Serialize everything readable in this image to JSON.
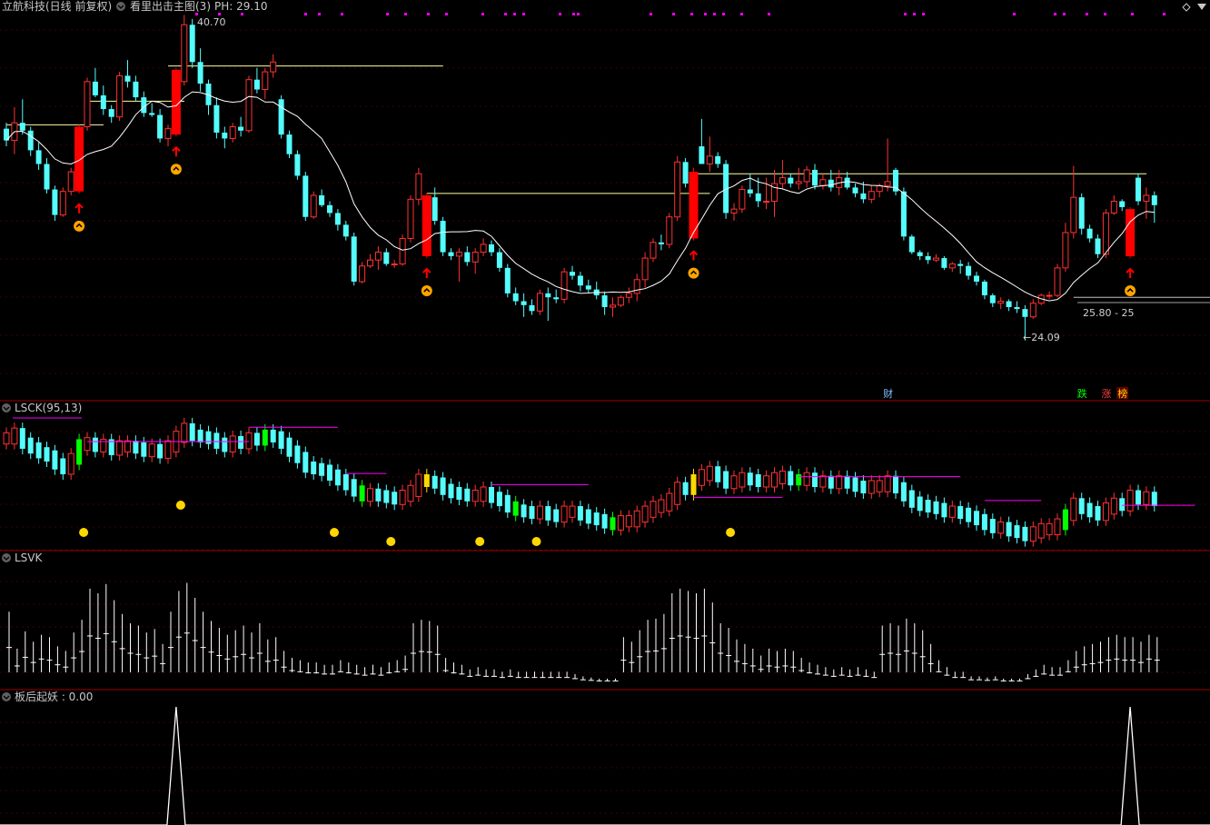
{
  "header": {
    "title": "立航科技(日线 前复权)",
    "indicator": "看里出击主图(3)",
    "ph": "PH: 29.10"
  },
  "panes": {
    "lsck": "LSCK(95,13)",
    "lsvk": "LSVK",
    "bhqy": "板后起妖 : 0.00"
  },
  "annotations": {
    "high_label": "40.70",
    "low_label": "←24.09",
    "range_label": "25.80 - 25",
    "tag_cai": "财",
    "tag_die": "跌",
    "tag_zhang": "涨",
    "tag_bang": "榜"
  },
  "colors": {
    "up": "#ff3232",
    "down": "#54fcfc",
    "signal": "#ff0000",
    "ma": "#ffffff",
    "level": "#ffffa0",
    "magenta": "#ff00ff",
    "gold": "#ffd700",
    "green": "#00ff00",
    "grid": "#400000",
    "divider": "#a00000"
  },
  "chart_data": {
    "type": "candlestick",
    "price_axis_range": [
      22.0,
      41.0
    ],
    "candles": [
      [
        34.9,
        35.2,
        34.0,
        34.3
      ],
      [
        34.3,
        36.0,
        33.6,
        35.2
      ],
      [
        35.2,
        36.4,
        34.6,
        34.8
      ],
      [
        34.8,
        35.0,
        33.5,
        33.8
      ],
      [
        33.8,
        34.2,
        32.8,
        33.1
      ],
      [
        33.1,
        33.4,
        31.6,
        31.8
      ],
      [
        31.8,
        32.0,
        30.2,
        30.5
      ],
      [
        30.5,
        31.9,
        30.4,
        31.7
      ],
      [
        31.7,
        32.9,
        31.5,
        32.7
      ],
      [
        32.6,
        35.1,
        32.2,
        35.0
      ],
      [
        35.0,
        37.5,
        34.8,
        37.3
      ],
      [
        37.3,
        38.0,
        36.5,
        36.6
      ],
      [
        36.6,
        37.1,
        35.6,
        35.9
      ],
      [
        35.9,
        36.1,
        35.2,
        35.5
      ],
      [
        35.5,
        37.8,
        35.3,
        37.6
      ],
      [
        37.6,
        38.4,
        37.0,
        37.3
      ],
      [
        37.3,
        37.6,
        36.3,
        36.5
      ],
      [
        36.5,
        36.8,
        35.5,
        35.7
      ],
      [
        35.7,
        36.2,
        35.5,
        35.6
      ],
      [
        35.6,
        35.9,
        34.2,
        34.4
      ],
      [
        34.4,
        35.1,
        34.0,
        34.9
      ],
      [
        34.9,
        37.5,
        34.6,
        37.3
      ],
      [
        37.3,
        40.7,
        37.1,
        40.2
      ],
      [
        40.2,
        40.5,
        38.0,
        38.3
      ],
      [
        38.3,
        39.0,
        36.8,
        37.2
      ],
      [
        37.2,
        37.4,
        35.6,
        36.1
      ],
      [
        36.1,
        36.5,
        34.4,
        34.7
      ],
      [
        34.7,
        35.0,
        33.9,
        34.4
      ],
      [
        34.4,
        35.2,
        34.2,
        35.0
      ],
      [
        35.0,
        35.5,
        34.5,
        34.8
      ],
      [
        34.8,
        37.6,
        34.7,
        37.4
      ],
      [
        37.4,
        38.0,
        36.7,
        36.9
      ],
      [
        36.9,
        38.0,
        36.4,
        37.8
      ],
      [
        37.8,
        38.7,
        37.5,
        38.3
      ],
      [
        36.4,
        36.6,
        34.4,
        34.6
      ],
      [
        34.6,
        34.8,
        33.4,
        33.6
      ],
      [
        33.6,
        33.8,
        32.3,
        32.5
      ],
      [
        32.5,
        32.7,
        30.2,
        30.4
      ],
      [
        30.4,
        31.7,
        30.3,
        31.5
      ],
      [
        31.5,
        31.8,
        30.9,
        31.0
      ],
      [
        31.0,
        31.2,
        30.4,
        30.6
      ],
      [
        30.6,
        30.8,
        29.7,
        30.0
      ],
      [
        30.0,
        30.2,
        29.2,
        29.4
      ],
      [
        29.4,
        29.6,
        26.9,
        27.1
      ],
      [
        27.1,
        28.1,
        27.0,
        27.9
      ],
      [
        27.9,
        28.5,
        27.8,
        28.2
      ],
      [
        28.2,
        28.9,
        27.7,
        28.6
      ],
      [
        28.6,
        28.8,
        27.9,
        28.0
      ],
      [
        28.0,
        28.2,
        27.8,
        28.0
      ],
      [
        28.0,
        29.5,
        27.9,
        29.3
      ],
      [
        29.3,
        31.5,
        29.1,
        31.3
      ],
      [
        31.3,
        32.9,
        31.0,
        32.6
      ],
      [
        32.6,
        33.5,
        31.1,
        31.4
      ],
      [
        31.4,
        31.9,
        30.0,
        30.2
      ],
      [
        30.2,
        30.4,
        28.4,
        28.6
      ],
      [
        28.6,
        28.8,
        28.2,
        28.4
      ],
      [
        28.4,
        28.8,
        27.1,
        28.6
      ],
      [
        28.6,
        28.9,
        27.9,
        28.1
      ],
      [
        28.1,
        28.8,
        27.5,
        28.6
      ],
      [
        28.6,
        29.3,
        28.4,
        29.0
      ],
      [
        29.0,
        29.2,
        28.4,
        28.6
      ],
      [
        28.6,
        28.8,
        27.6,
        27.8
      ],
      [
        27.8,
        28.0,
        26.3,
        26.5
      ],
      [
        26.5,
        26.8,
        25.9,
        26.1
      ],
      [
        26.1,
        26.5,
        25.3,
        25.9
      ],
      [
        25.9,
        26.2,
        25.4,
        25.6
      ],
      [
        25.6,
        26.7,
        25.4,
        26.5
      ],
      [
        26.5,
        26.8,
        25.1,
        26.3
      ],
      [
        26.3,
        26.7,
        26.0,
        26.2
      ],
      [
        26.2,
        27.8,
        26.0,
        27.6
      ],
      [
        27.6,
        27.9,
        27.2,
        27.4
      ],
      [
        27.4,
        27.6,
        26.6,
        26.9
      ],
      [
        26.9,
        27.2,
        26.5,
        26.7
      ],
      [
        26.7,
        27.1,
        26.2,
        26.4
      ],
      [
        26.4,
        26.6,
        25.4,
        25.8
      ],
      [
        25.8,
        26.3,
        25.3,
        25.9
      ],
      [
        25.9,
        26.4,
        25.8,
        26.3
      ],
      [
        26.3,
        26.8,
        26.0,
        26.5
      ],
      [
        26.5,
        27.5,
        26.1,
        27.2
      ],
      [
        27.2,
        28.6,
        26.8,
        28.3
      ],
      [
        28.3,
        29.3,
        28.1,
        29.1
      ],
      [
        29.1,
        29.5,
        28.7,
        29.0
      ],
      [
        29.0,
        30.6,
        28.8,
        30.4
      ],
      [
        30.4,
        33.5,
        30.2,
        33.2
      ],
      [
        33.2,
        33.4,
        31.9,
        32.1
      ],
      [
        32.1,
        34.2,
        31.9,
        34.0
      ],
      [
        34.0,
        35.4,
        33.2,
        33.1
      ],
      [
        33.1,
        34.5,
        32.7,
        33.5
      ],
      [
        33.5,
        33.7,
        32.9,
        33.1
      ],
      [
        33.1,
        33.3,
        30.3,
        30.6
      ],
      [
        30.6,
        31.1,
        30.2,
        30.8
      ],
      [
        30.8,
        32.0,
        30.6,
        31.8
      ],
      [
        31.8,
        32.6,
        31.4,
        31.6
      ],
      [
        31.6,
        32.4,
        30.9,
        31.2
      ],
      [
        31.2,
        32.4,
        30.8,
        31.2
      ],
      [
        31.2,
        32.8,
        30.4,
        32.1
      ],
      [
        32.1,
        33.3,
        31.8,
        32.4
      ],
      [
        32.4,
        32.6,
        31.9,
        32.1
      ],
      [
        32.1,
        32.9,
        31.8,
        32.2
      ],
      [
        32.2,
        33.0,
        31.9,
        32.8
      ],
      [
        32.8,
        33.1,
        31.8,
        32.0
      ],
      [
        32.0,
        32.6,
        31.8,
        32.3
      ],
      [
        32.3,
        32.8,
        31.7,
        31.9
      ],
      [
        31.9,
        32.8,
        31.5,
        32.4
      ],
      [
        32.4,
        32.7,
        31.8,
        31.9
      ],
      [
        31.9,
        32.1,
        31.4,
        31.6
      ],
      [
        31.6,
        32.2,
        31.1,
        31.3
      ],
      [
        31.3,
        32.0,
        31.1,
        31.7
      ],
      [
        31.7,
        32.1,
        31.4,
        32.0
      ],
      [
        32.0,
        34.4,
        31.7,
        32.2
      ],
      [
        32.8,
        32.9,
        31.5,
        31.7
      ],
      [
        31.7,
        31.9,
        29.2,
        29.4
      ],
      [
        29.4,
        29.5,
        28.5,
        28.6
      ],
      [
        28.6,
        28.7,
        28.2,
        28.4
      ],
      [
        28.4,
        28.6,
        28.0,
        28.2
      ],
      [
        28.2,
        28.5,
        28.1,
        28.3
      ],
      [
        28.3,
        28.4,
        27.7,
        27.8
      ],
      [
        27.8,
        28.1,
        27.6,
        28.0
      ],
      [
        28.0,
        28.2,
        27.5,
        27.9
      ],
      [
        27.9,
        28.1,
        27.2,
        27.4
      ],
      [
        27.4,
        27.6,
        26.9,
        27.1
      ],
      [
        27.1,
        27.2,
        26.2,
        26.4
      ],
      [
        26.4,
        26.5,
        25.8,
        26.0
      ],
      [
        26.0,
        26.3,
        25.7,
        26.1
      ],
      [
        26.1,
        26.2,
        25.6,
        25.8
      ],
      [
        25.8,
        26.1,
        25.5,
        25.7
      ],
      [
        25.7,
        25.9,
        24.1,
        25.3
      ],
      [
        25.3,
        26.2,
        25.2,
        26.0
      ],
      [
        26.0,
        26.5,
        25.9,
        26.4
      ],
      [
        26.4,
        26.6,
        26.2,
        26.4
      ],
      [
        26.4,
        28.0,
        26.3,
        27.8
      ],
      [
        27.8,
        30.1,
        27.6,
        29.6
      ],
      [
        29.6,
        33.0,
        29.3,
        31.4
      ],
      [
        31.4,
        31.6,
        29.5,
        29.8
      ],
      [
        29.8,
        30.0,
        29.1,
        29.3
      ],
      [
        29.3,
        29.5,
        28.3,
        28.5
      ],
      [
        28.5,
        30.8,
        28.3,
        30.6
      ],
      [
        30.6,
        31.5,
        30.5,
        31.2
      ],
      [
        31.2,
        31.3,
        30.7,
        30.9
      ],
      [
        30.9,
        32.7,
        30.7,
        32.4
      ],
      [
        32.4,
        32.6,
        31.0,
        31.2
      ],
      [
        31.2,
        31.9,
        30.3,
        31.5
      ],
      [
        31.5,
        31.7,
        30.1,
        31.0
      ]
    ],
    "signals": [
      {
        "index": 9,
        "open": 31.7,
        "close": 35.0,
        "high": 35.1,
        "low": 31.6
      },
      {
        "index": 21,
        "open": 34.6,
        "close": 37.9,
        "high": 38.0,
        "low": 34.5
      },
      {
        "index": 52,
        "open": 28.4,
        "close": 31.5,
        "high": 31.6,
        "low": 28.3
      },
      {
        "index": 85,
        "open": 29.3,
        "close": 32.7,
        "high": 32.9,
        "low": 29.2
      },
      {
        "index": 139,
        "open": 28.4,
        "close": 30.8,
        "high": 30.9,
        "low": 28.3
      }
    ],
    "levels": [
      {
        "value": 35.1,
        "from": 0,
        "to": 10
      },
      {
        "value": 36.3,
        "from": 10,
        "to": 20
      },
      {
        "value": 38.1,
        "from": 20,
        "to": 52
      },
      {
        "value": 31.6,
        "from": 52,
        "to": 85
      },
      {
        "value": 32.6,
        "from": 85,
        "to": 139
      },
      {
        "value": 26.3,
        "from": 132,
        "to": 148
      }
    ],
    "markers": {
      "arrows": [
        9,
        21,
        52,
        85,
        139
      ],
      "circles": [
        9,
        21,
        52,
        85,
        139
      ]
    },
    "lsck": {
      "type": "bar",
      "values": [
        36.2,
        36.5,
        35.9,
        35.6,
        35.3,
        35.1,
        34.6,
        34.3,
        34.9,
        35.8,
        35.9,
        35.7,
        35.8,
        35.5,
        35.7,
        35.7,
        35.6,
        35.4,
        35.5,
        35.3,
        35.7,
        36.3,
        36.8,
        36.4,
        36.3,
        36.2,
        35.9,
        35.7,
        36.0,
        35.9,
        36.2,
        36.1,
        36.4,
        36.3,
        35.9,
        35.4,
        35.0,
        34.4,
        34.3,
        34.2,
        33.9,
        33.6,
        33.3,
        32.9,
        32.6,
        32.7,
        32.6,
        32.5,
        32.4,
        32.6,
        32.9,
        33.6,
        33.5,
        33.4,
        33.0,
        32.8,
        32.7,
        32.6,
        32.6,
        32.8,
        32.5,
        32.3,
        31.9,
        31.7,
        31.6,
        31.5,
        31.6,
        31.4,
        31.3,
        31.6,
        31.6,
        31.4,
        31.2,
        31.1,
        30.9,
        30.8,
        31.0,
        31.0,
        31.3,
        31.6,
        31.9,
        32.0,
        32.4,
        33.1,
        33.0,
        33.6,
        33.9,
        34.1,
        33.8,
        33.4,
        33.5,
        33.7,
        33.6,
        33.5,
        33.5,
        33.7,
        33.8,
        33.6,
        33.6,
        33.7,
        33.5,
        33.5,
        33.4,
        33.5,
        33.4,
        33.2,
        33.1,
        33.2,
        33.2,
        33.5,
        33.1,
        32.6,
        32.2,
        32.0,
        31.9,
        31.8,
        31.6,
        31.6,
        31.5,
        31.3,
        31.1,
        30.8,
        30.6,
        30.6,
        30.4,
        30.3,
        30.1,
        30.3,
        30.5,
        30.5,
        30.8,
        31.4,
        32.1,
        31.8,
        31.6,
        31.4,
        31.8,
        32.1,
        32.0,
        32.6,
        32.4,
        32.5,
        32.3
      ],
      "dots": [
        9,
        21,
        40,
        47,
        58,
        65,
        89
      ]
    },
    "lsvk": {
      "type": "bar",
      "values": [
        0.62,
        0.3,
        0.45,
        0.36,
        0.42,
        0.4,
        0.32,
        0.28,
        0.44,
        0.55,
        0.82,
        0.78,
        0.86,
        0.72,
        0.6,
        0.52,
        0.5,
        0.44,
        0.47,
        0.34,
        0.62,
        0.8,
        0.87,
        0.74,
        0.62,
        0.54,
        0.48,
        0.42,
        0.46,
        0.5,
        0.44,
        0.52,
        0.38,
        0.4,
        0.28,
        0.22,
        0.2,
        0.18,
        0.18,
        0.16,
        0.16,
        0.2,
        0.18,
        0.16,
        0.14,
        0.16,
        0.14,
        0.18,
        0.2,
        0.24,
        0.52,
        0.55,
        0.54,
        0.5,
        0.22,
        0.18,
        0.16,
        0.12,
        0.14,
        0.12,
        0.12,
        0.1,
        0.12,
        0.1,
        0.1,
        0.1,
        0.1,
        0.1,
        0.1,
        0.1,
        0.08,
        0.06,
        0.05,
        0.04,
        0.04,
        0.04,
        0.4,
        0.36,
        0.46,
        0.55,
        0.56,
        0.6,
        0.78,
        0.82,
        0.8,
        0.78,
        0.82,
        0.7,
        0.52,
        0.48,
        0.38,
        0.34,
        0.3,
        0.24,
        0.3,
        0.28,
        0.3,
        0.28,
        0.22,
        0.18,
        0.16,
        0.14,
        0.12,
        0.14,
        0.12,
        0.14,
        0.12,
        0.1,
        0.5,
        0.52,
        0.5,
        0.56,
        0.52,
        0.46,
        0.34,
        0.2,
        0.14,
        0.1,
        0.1,
        0.06,
        0.06,
        0.05,
        0.06,
        0.04,
        0.04,
        0.04,
        0.08,
        0.12,
        0.16,
        0.14,
        0.14,
        0.2,
        0.28,
        0.32,
        0.34,
        0.36,
        0.4,
        0.42,
        0.4,
        0.4,
        0.36,
        0.42,
        0.4
      ]
    },
    "bhqy": {
      "type": "line",
      "spikes": [
        21,
        139
      ],
      "ylim": [
        0,
        1
      ]
    },
    "tags": [
      {
        "text_key": "tag_cai",
        "index": 109
      },
      {
        "text_key": "tag_die",
        "index": 133
      },
      {
        "text_key": "tag_zhang",
        "index": 136
      },
      {
        "text_key": "tag_bang",
        "index": 138
      }
    ]
  }
}
